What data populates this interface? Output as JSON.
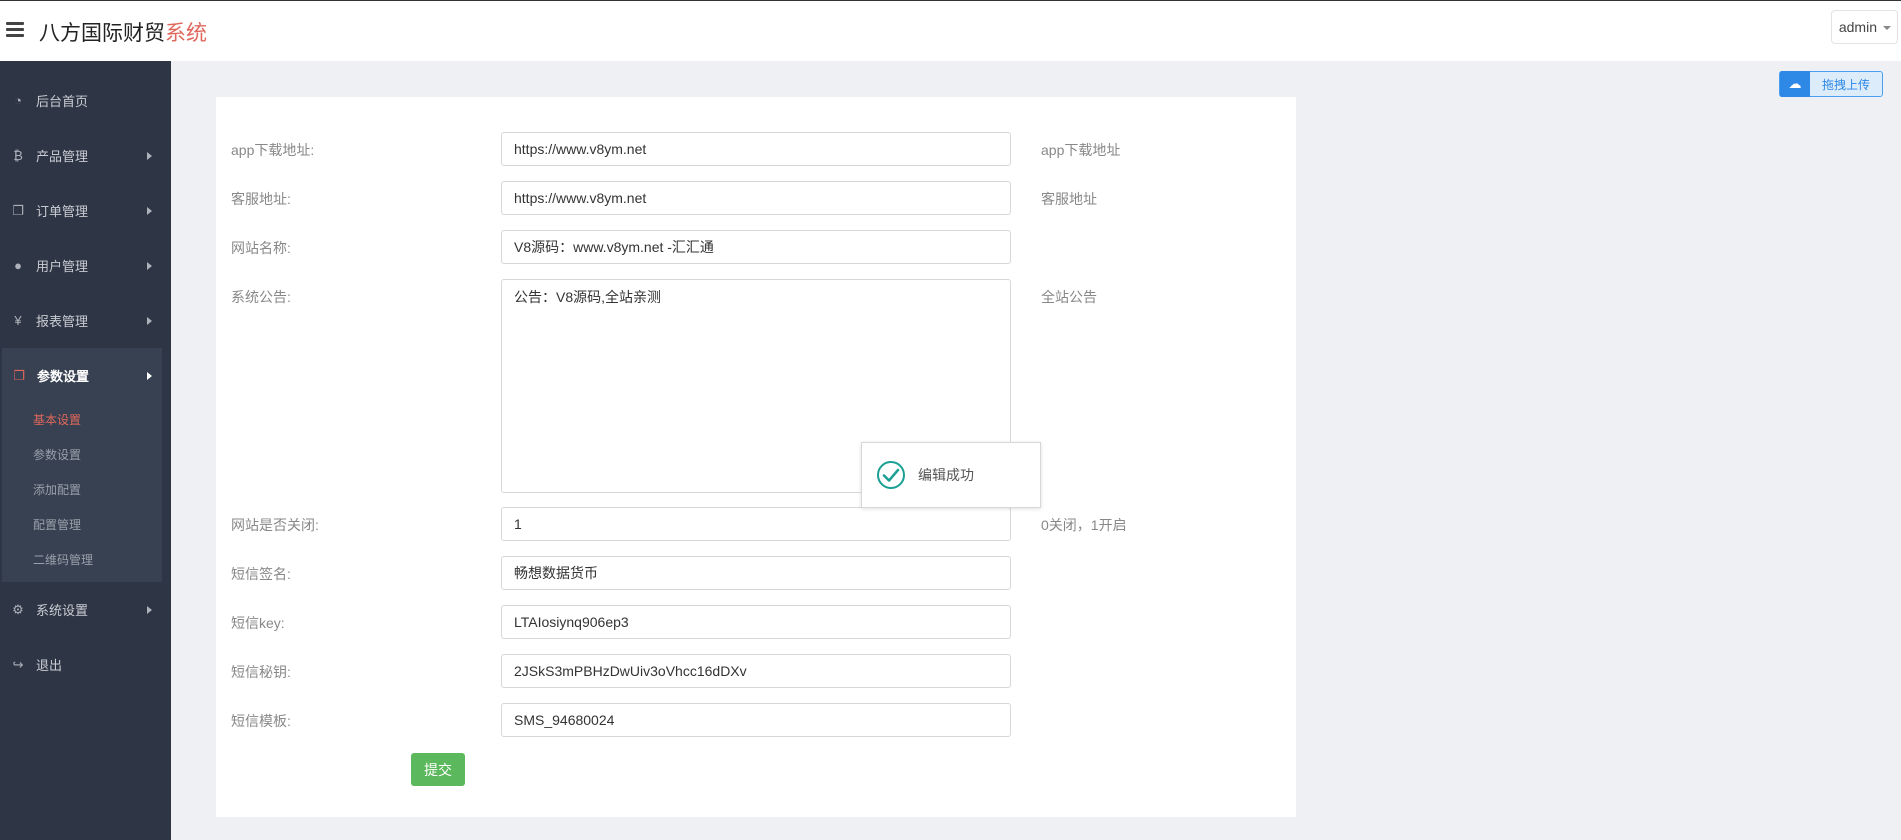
{
  "header": {
    "brand_main": "八方国际财贸",
    "brand_accent": "系统",
    "user": "admin"
  },
  "sidebar": {
    "items": [
      {
        "label": "后台首页",
        "icon": "dashboard-icon"
      },
      {
        "label": "产品管理",
        "icon": "bitcoin-icon"
      },
      {
        "label": "订单管理",
        "icon": "copy-icon"
      },
      {
        "label": "用户管理",
        "icon": "user-icon"
      },
      {
        "label": "报表管理",
        "icon": "yen-icon"
      },
      {
        "label": "参数设置",
        "icon": "copy-icon"
      },
      {
        "label": "系统设置",
        "icon": "gears-icon"
      },
      {
        "label": "退出",
        "icon": "sign-out-icon"
      }
    ],
    "sub_items": [
      "基本设置",
      "参数设置",
      "添加配置",
      "配置管理",
      "二维码管理"
    ]
  },
  "upload_button": {
    "label": "拖拽上传"
  },
  "form": {
    "fields": [
      {
        "label": "app下载地址:",
        "value": "https://www.v8ym.net",
        "help": "app下载地址"
      },
      {
        "label": "客服地址:",
        "value": "https://www.v8ym.net",
        "help": "客服地址"
      },
      {
        "label": "网站名称:",
        "value": "V8源码：www.v8ym.net -汇汇通",
        "help": ""
      },
      {
        "label": "系统公告:",
        "value": "公告：V8源码,全站亲测",
        "help": "全站公告"
      },
      {
        "label": "网站是否关闭:",
        "value": "1",
        "help": "0关闭，1开启"
      },
      {
        "label": "短信签名:",
        "value": "畅想数据货币",
        "help": ""
      },
      {
        "label": "短信key:",
        "value": "LTAIosiynq906ep3",
        "help": ""
      },
      {
        "label": "短信秘钥:",
        "value": "2JSkS3mPBHzDwUiv3oVhcc16dDXv",
        "help": ""
      },
      {
        "label": "短信模板:",
        "value": "SMS_94680024",
        "help": ""
      }
    ],
    "submit_label": "提交"
  },
  "toast": {
    "message": "编辑成功"
  },
  "colors": {
    "sidebar_bg": "#2e3646",
    "accent_red": "#e0675c",
    "submit_green": "#5cb85c",
    "upload_blue": "#2d88e6",
    "success_teal": "#1aa094"
  }
}
